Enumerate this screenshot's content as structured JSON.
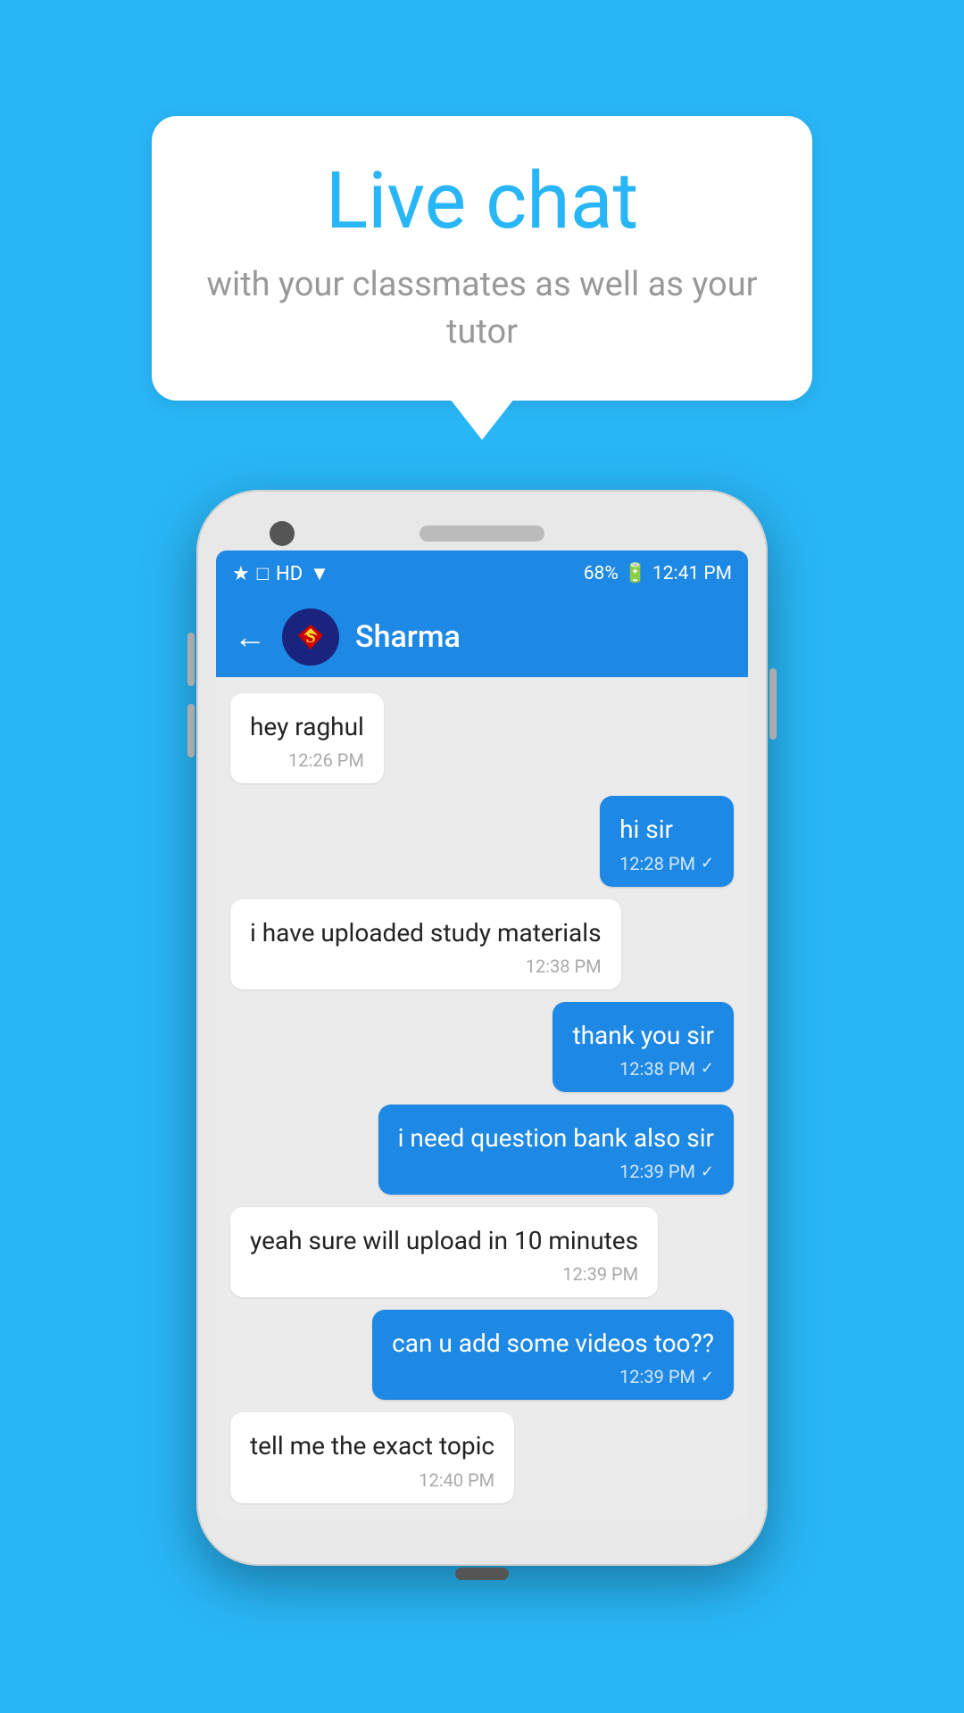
{
  "bubble": {
    "title": "Live chat",
    "subtitle": "with your classmates as well as your tutor"
  },
  "status_bar": {
    "time": "12:41 PM",
    "battery": "68%",
    "icons": "bluetooth signal hd wifi bars"
  },
  "chat_header": {
    "contact_name": "Sharma",
    "back_label": "←"
  },
  "messages": [
    {
      "type": "received",
      "text": "hey raghul",
      "time": "12:26 PM"
    },
    {
      "type": "sent",
      "text": "hi sir",
      "time": "12:28 PM"
    },
    {
      "type": "received",
      "text": "i have uploaded study materials",
      "time": "12:38 PM"
    },
    {
      "type": "sent",
      "text": "thank you sir",
      "time": "12:38 PM"
    },
    {
      "type": "sent",
      "text": "i need question bank also sir",
      "time": "12:39 PM"
    },
    {
      "type": "received",
      "text": "yeah sure will upload in 10 minutes",
      "time": "12:39 PM"
    },
    {
      "type": "sent",
      "text": "can u add some videos too??",
      "time": "12:39 PM"
    },
    {
      "type": "received",
      "text": "tell me the exact topic",
      "time": "12:40 PM"
    }
  ]
}
